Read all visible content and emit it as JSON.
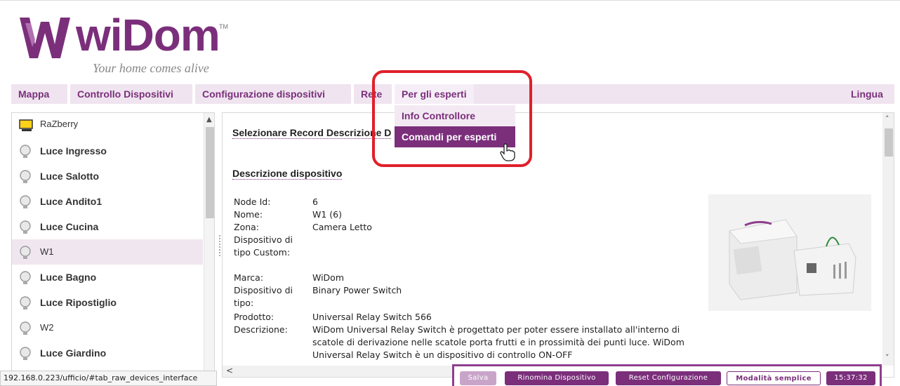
{
  "logo": {
    "brand": "wiDom",
    "trademark": "TM",
    "tagline": "Your home comes alive"
  },
  "menu": {
    "items": [
      "Mappa",
      "Controllo Dispositivi",
      "Configurazione dispositivi",
      "Rete",
      "Per gli esperti"
    ],
    "right": "Lingua",
    "dropdown": [
      "Info Controllore",
      "Comandi per esperti"
    ]
  },
  "devices": [
    {
      "label": "RaZberry",
      "icon": "monitor-icon"
    },
    {
      "label": "Luce Ingresso",
      "icon": "bulb-icon"
    },
    {
      "label": "Luce Salotto",
      "icon": "bulb-icon"
    },
    {
      "label": "Luce Andito1",
      "icon": "bulb-icon"
    },
    {
      "label": "Luce Cucina",
      "icon": "bulb-icon"
    },
    {
      "label": "W1",
      "icon": "bulb-icon"
    },
    {
      "label": "Luce Bagno",
      "icon": "bulb-icon"
    },
    {
      "label": "Luce Ripostiglio",
      "icon": "bulb-icon"
    },
    {
      "label": "W2",
      "icon": "bulb-icon"
    },
    {
      "label": "Luce Giardino",
      "icon": "bulb-icon"
    }
  ],
  "main": {
    "record_title": "Selezionare Record Descrizione D",
    "section_title": "Descrizione dispositivo",
    "fields": [
      {
        "k": "Node Id:",
        "v": "6"
      },
      {
        "k": "Nome:",
        "v": "W1 (6)"
      },
      {
        "k": "Zona:",
        "v": "Camera Letto"
      },
      {
        "k": "Dispositivo di tipo Custom:",
        "v": ""
      },
      {
        "k": "Marca:",
        "v": "WiDom"
      },
      {
        "k": "Dispositivo di tipo:",
        "v": "Binary Power Switch"
      },
      {
        "k": "Prodotto:",
        "v": "Universal Relay Switch 566"
      },
      {
        "k": "Descrizione:",
        "v": "WiDom Universal Relay Switch è progettato per poter essere installato all'interno di scatole di derivazione nelle scatole porta frutti e in prossimità dei punti luce. WiDom Universal Relay Switch è un dispositivo di controllo ON-OFF"
      }
    ]
  },
  "toolbar": {
    "save": "Salva",
    "rename": "Rinomina Dispositivo",
    "reset": "Reset Configurazione",
    "mode": "Modalità semplice",
    "time": "15:37:32"
  },
  "status_url": "192.168.0.223/ufficio/#tab_raw_devices_interface",
  "colors": {
    "accent": "#7b2f7b",
    "menu_bg": "#efe4ef",
    "highlight": "#e0202b"
  }
}
